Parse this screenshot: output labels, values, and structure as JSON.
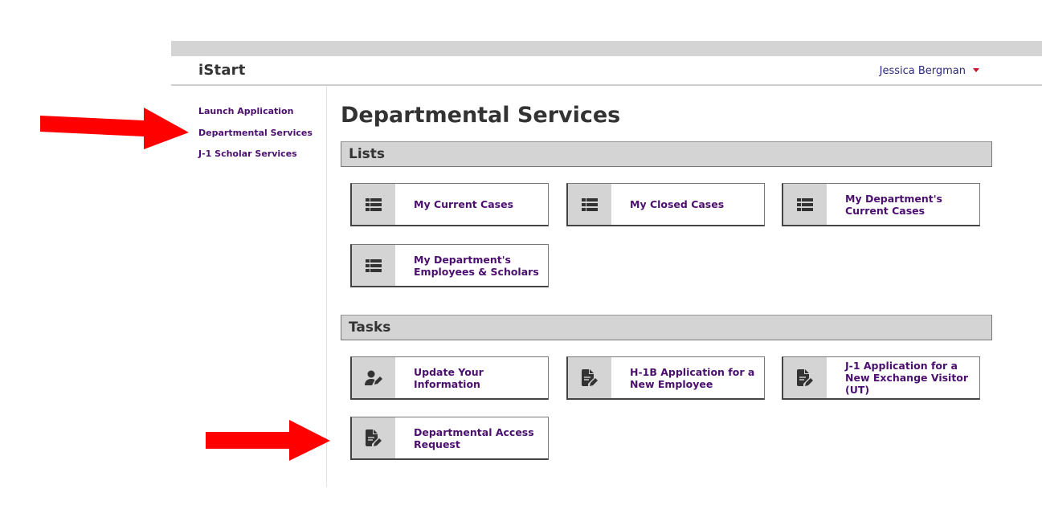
{
  "header": {
    "app_title": "iStart",
    "user_name": "Jessica Bergman",
    "user_menu_icon": "caret-down-icon"
  },
  "sidebar": {
    "items": [
      {
        "label": "Launch Application"
      },
      {
        "label": "Departmental Services"
      },
      {
        "label": "J-1 Scholar Services"
      }
    ]
  },
  "main": {
    "title": "Departmental Services",
    "sections": [
      {
        "heading": "Lists",
        "tiles": [
          {
            "label": "My Current Cases",
            "icon": "list-icon"
          },
          {
            "label": "My Closed Cases",
            "icon": "list-icon"
          },
          {
            "label": "My Department's Current Cases",
            "icon": "list-icon"
          },
          {
            "label": "My Department's Employees & Scholars",
            "icon": "list-icon"
          }
        ]
      },
      {
        "heading": "Tasks",
        "tiles": [
          {
            "label": "Update Your Information",
            "icon": "user-edit-icon"
          },
          {
            "label": "H-1B Application for a New Employee",
            "icon": "file-edit-icon"
          },
          {
            "label": "J-1 Application for a New Exchange Visitor (UT)",
            "icon": "file-edit-icon"
          },
          {
            "label": "Departmental Access Request",
            "icon": "file-edit-icon"
          }
        ]
      }
    ]
  },
  "annotations": {
    "arrow_color": "#ff0000",
    "arrows": [
      "points-to-departmental-services",
      "points-to-departmental-access-request"
    ]
  }
}
